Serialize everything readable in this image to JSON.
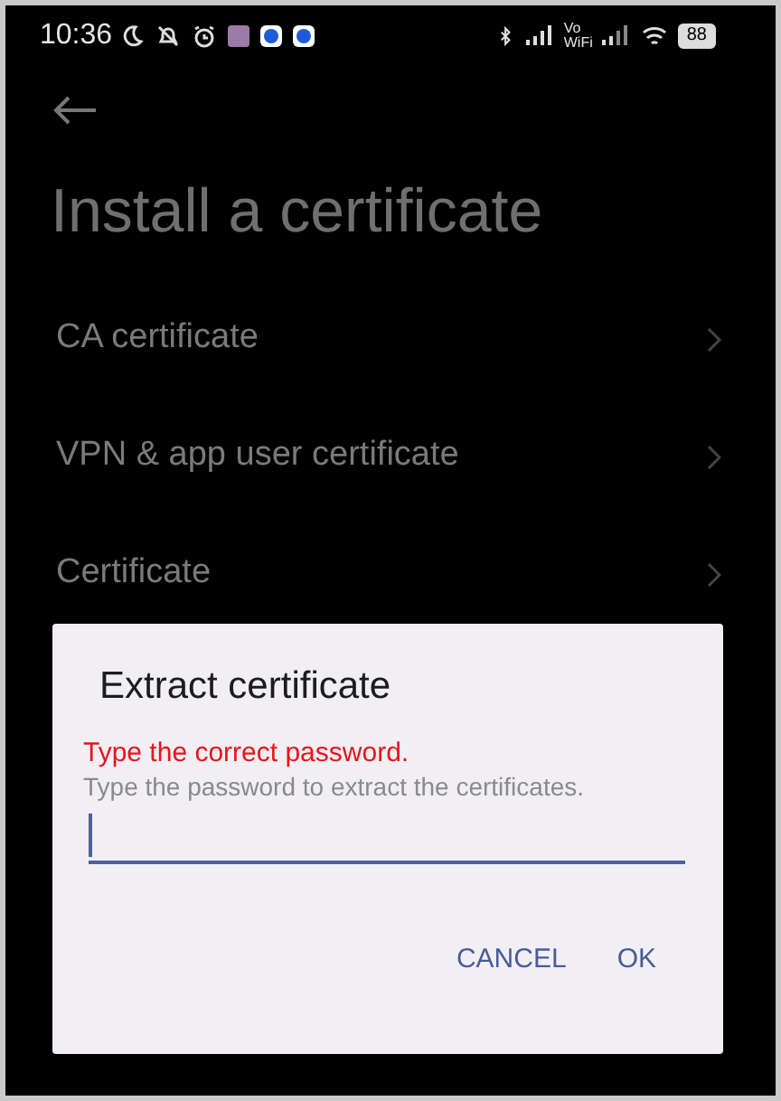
{
  "status_bar": {
    "time": "10:36",
    "vo": "Vo",
    "wifi": "WiFi",
    "battery": "88"
  },
  "page": {
    "title": "Install a certificate",
    "items": [
      {
        "label": "CA certificate"
      },
      {
        "label": "VPN & app user certificate"
      },
      {
        "label": "Certificate"
      }
    ]
  },
  "dialog": {
    "title": "Extract certificate",
    "error": "Type the correct password.",
    "hint": "Type the password to extract the certificates.",
    "buttons": [
      {
        "label": "CANCEL"
      },
      {
        "label": "OK"
      }
    ]
  }
}
